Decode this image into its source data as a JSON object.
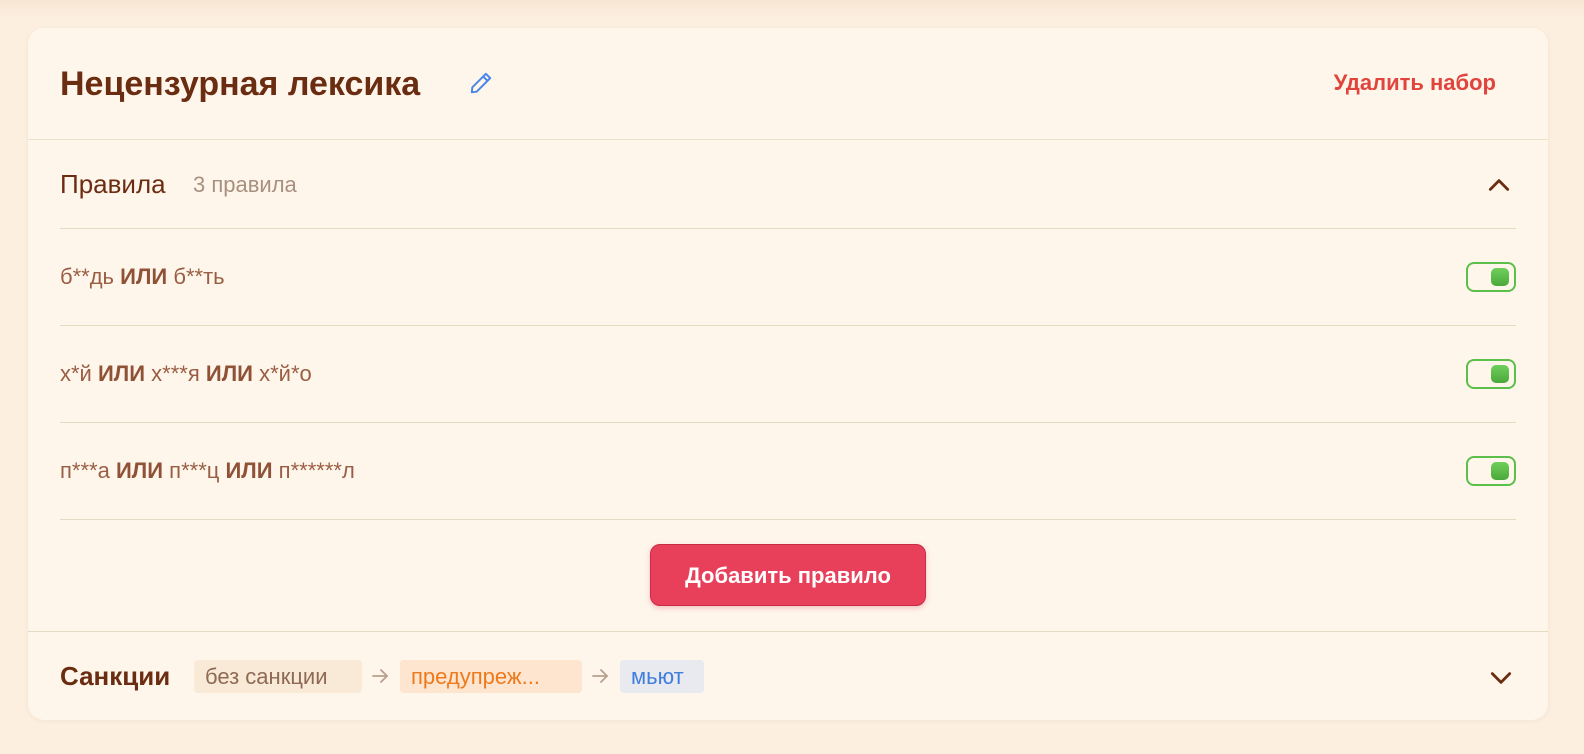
{
  "set": {
    "title": "Нецензурная лексика",
    "delete_label": "Удалить набор"
  },
  "rules": {
    "title": "Правила",
    "count": "3 правила",
    "items": [
      {
        "parts": [
          "б**дь",
          "ИЛИ",
          "б**ть"
        ],
        "enabled": true
      },
      {
        "parts": [
          "х*й",
          "ИЛИ",
          "х***я",
          "ИЛИ",
          "х*й*о"
        ],
        "enabled": true
      },
      {
        "parts": [
          "п***а",
          "ИЛИ",
          "п***ц",
          "ИЛИ",
          "п******л"
        ],
        "enabled": true
      }
    ],
    "add_label": "Добавить правило"
  },
  "sanctions": {
    "title": "Санкции",
    "steps": [
      "без санкции",
      "предупреж...",
      "мьют"
    ]
  },
  "icons": {
    "edit": "pencil-icon",
    "collapse": "chevron-up-icon",
    "expand": "chevron-down-icon",
    "arrow": "arrow-right-icon"
  },
  "colors": {
    "accent": "#e8405a",
    "danger": "#e0443d",
    "toggle_on": "#5bbf4a",
    "title": "#6b2d12",
    "warn": "#ee7a1c",
    "mute": "#3f7ede"
  }
}
